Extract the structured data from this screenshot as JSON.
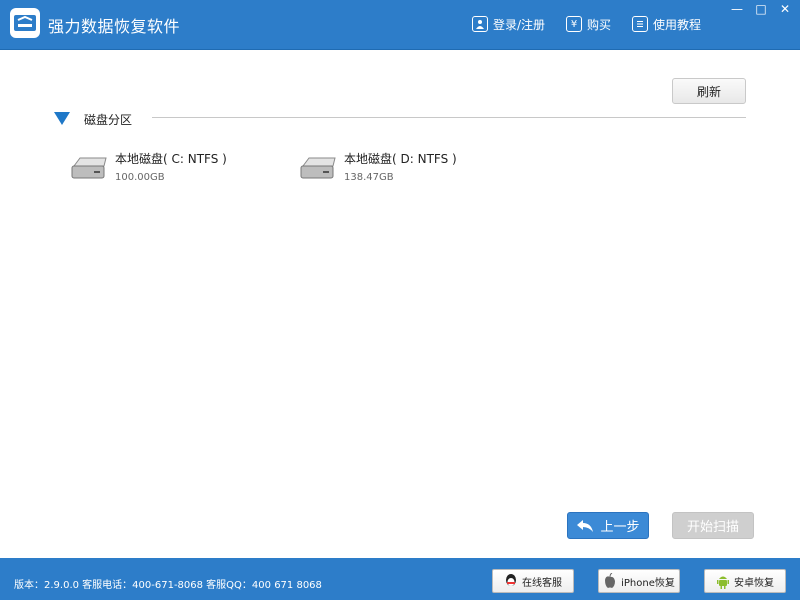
{
  "app": {
    "title": "强力数据恢复软件"
  },
  "header": {
    "actions": [
      {
        "label": "登录/注册",
        "icon": "user-login-icon"
      },
      {
        "label": "购买",
        "icon": "yen-icon"
      },
      {
        "label": "使用教程",
        "icon": "document-icon"
      }
    ],
    "window_controls": {
      "minimize": "—",
      "maximize": "□",
      "close": "✕"
    }
  },
  "main": {
    "refresh_label": "刷新",
    "section_label": "磁盘分区",
    "disks": [
      {
        "name": "本地磁盘( C: NTFS )",
        "size": "100.00GB"
      },
      {
        "name": "本地磁盘( D: NTFS )",
        "size": "138.47GB"
      }
    ],
    "back_label": "上一步",
    "scan_label": "开始扫描"
  },
  "footer": {
    "info": "版本：2.9.0.0 客服电话：400-671-8068   客服QQ：400 671 8068",
    "buttons": [
      {
        "label": "在线客服",
        "icon": "qq-icon"
      },
      {
        "label": "iPhone恢复",
        "icon": "apple-icon"
      },
      {
        "label": "安卓恢复",
        "icon": "android-icon"
      }
    ]
  },
  "colors": {
    "primary": "#2d7dc9",
    "accent_button": "#3c8ad6",
    "disabled_button": "#cfcfcf"
  }
}
